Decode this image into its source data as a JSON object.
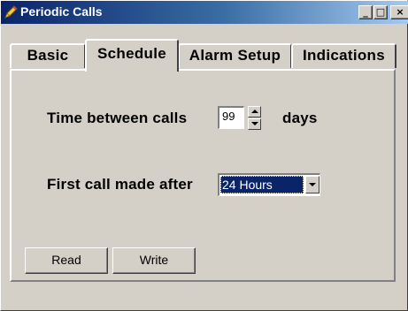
{
  "window": {
    "title": "Periodic Calls",
    "controls": {
      "minimize": "_",
      "maximize": "□",
      "close": "×"
    }
  },
  "tabs": [
    {
      "label": "Basic",
      "active": false
    },
    {
      "label": "Schedule",
      "active": true
    },
    {
      "label": "Alarm Setup",
      "active": false
    },
    {
      "label": "Indications",
      "active": false
    }
  ],
  "schedule": {
    "time_between_calls_label": "Time between calls",
    "time_between_calls_value": "99",
    "time_unit": "days",
    "first_call_label": "First call made after",
    "first_call_value": "24 Hours"
  },
  "buttons": {
    "read": "Read",
    "write": "Write"
  },
  "colors": {
    "face": "#d4d0c8",
    "title_active": "#0a246a",
    "selection": "#0a246a"
  },
  "icons": {
    "app": "pencil-icon"
  }
}
